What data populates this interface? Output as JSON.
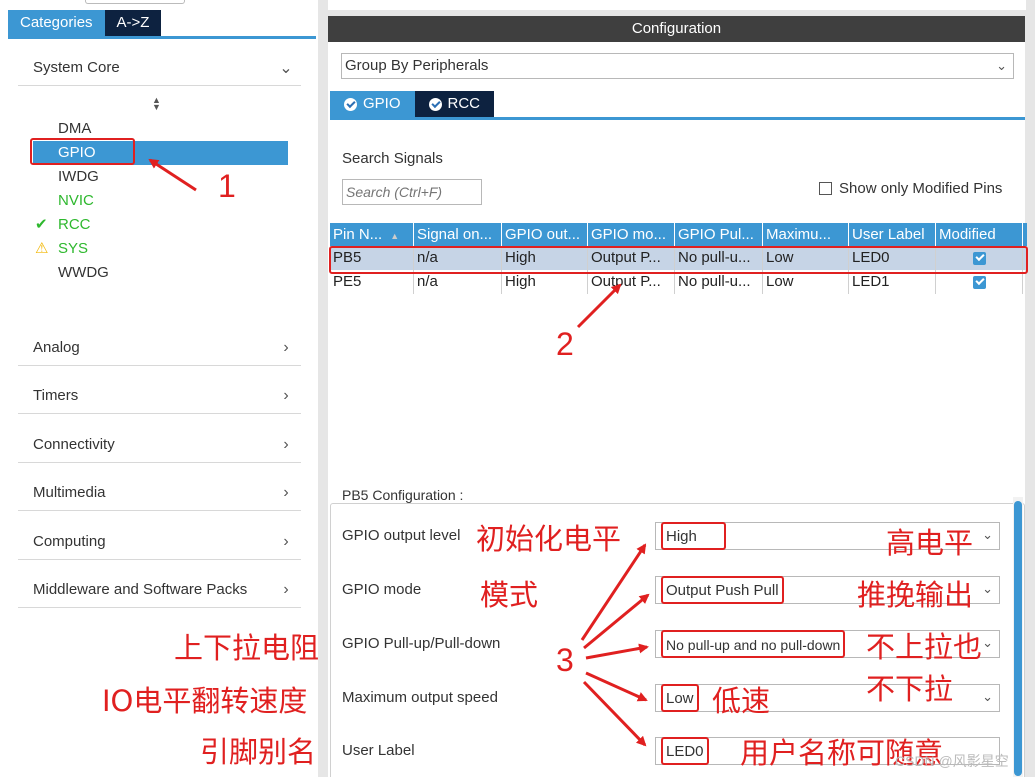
{
  "left": {
    "tabs": [
      "Categories",
      "A->Z"
    ],
    "categories_top": "System Core",
    "items": [
      {
        "label": "DMA",
        "status": "none"
      },
      {
        "label": "GPIO",
        "status": "selected"
      },
      {
        "label": "IWDG",
        "status": "none"
      },
      {
        "label": "NVIC",
        "status": "enabled"
      },
      {
        "label": "RCC",
        "status": "ok"
      },
      {
        "label": "SYS",
        "status": "warning"
      },
      {
        "label": "WWDG",
        "status": "none"
      }
    ],
    "categories": [
      "Analog",
      "Timers",
      "Connectivity",
      "Multimedia",
      "Computing",
      "Middleware and Software Packs"
    ]
  },
  "right": {
    "title": "Configuration",
    "group_by": "Group By Peripherals",
    "tabs": [
      "GPIO",
      "RCC"
    ],
    "search_label": "Search Signals",
    "search_placeholder": "Search (Ctrl+F)",
    "show_modified": "Show only Modified Pins",
    "columns": [
      "Pin N...",
      "Signal on...",
      "GPIO out...",
      "GPIO mo...",
      "GPIO Pul...",
      "Maximu...",
      "User Label",
      "Modified"
    ],
    "rows": [
      [
        "PB5",
        "n/a",
        "High",
        "Output P...",
        "No pull-u...",
        "Low",
        "LED0",
        "checked"
      ],
      [
        "PE5",
        "n/a",
        "High",
        "Output P...",
        "No pull-u...",
        "Low",
        "LED1",
        "checked"
      ]
    ],
    "config_title": "PB5 Configuration :",
    "fields": [
      {
        "label": "GPIO output level",
        "value": "High"
      },
      {
        "label": "GPIO mode",
        "value": "Output Push Pull"
      },
      {
        "label": "GPIO Pull-up/Pull-down",
        "value": "No pull-up and no pull-down"
      },
      {
        "label": "Maximum output speed",
        "value": "Low"
      },
      {
        "label": "User Label",
        "value": "LED0"
      }
    ]
  },
  "annotations": {
    "n1": "1",
    "n2": "2",
    "n3": "3",
    "init_level": "初始化电平",
    "high_level": "高电平",
    "mode": "模式",
    "push_pull": "推挽输出",
    "pull": "上下拉电阻",
    "no_pull_1": "不上拉也",
    "no_pull_2": "不下拉",
    "speed": "IO电平翻转速度",
    "low_speed": "低速",
    "pin_alias": "引脚别名",
    "user_name": "用户名称可随意",
    "watermark": "CSDN @风影星空"
  },
  "colors": {
    "accent": "#3c97d3",
    "dark_tab": "#0d2240",
    "annotation": "#e02020"
  }
}
